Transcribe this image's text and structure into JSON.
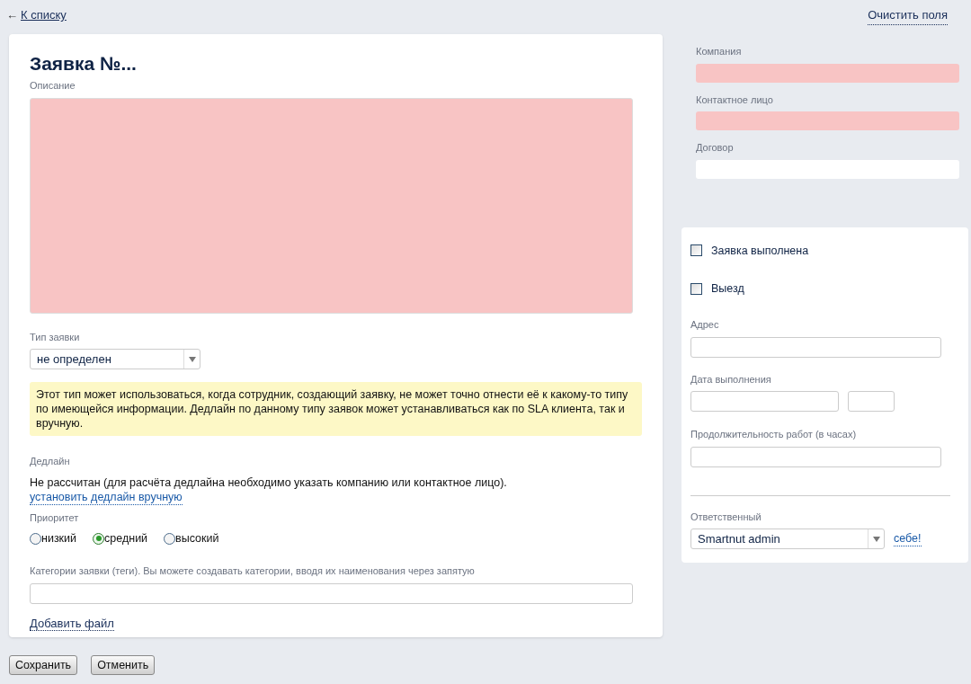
{
  "back_link": {
    "arrow": "←",
    "label": "К списку"
  },
  "clear_link": "Очистить поля",
  "form": {
    "title": "Заявка №...",
    "description": {
      "label": "Описание",
      "invalid": true
    },
    "type": {
      "label": "Тип заявки",
      "value": "не определен"
    },
    "type_hint": "Этот тип может использоваться, когда сотрудник, создающий заявку, не может точно отнести её к какому-то типу по имеющейся информации. Дедлайн по данному типу заявок может устанавливаться как по SLA клиента, так и вручную.",
    "deadline": {
      "label": "Дедлайн",
      "text": "Не рассчитан (для расчёта дедлайна необходимо указать компанию или контактное лицо).",
      "link": "установить дедлайн вручную"
    },
    "priority": {
      "label": "Приоритет",
      "options": [
        {
          "label": "низкий",
          "selected": false
        },
        {
          "label": "средний",
          "selected": true
        },
        {
          "label": "высокий",
          "selected": false
        }
      ]
    },
    "tags": {
      "label": "Категории заявки (теги). Вы можете создавать категории, вводя их наименования через запятую"
    },
    "add_file": "Добавить файл"
  },
  "client": [
    {
      "label": "Компания",
      "invalid": true
    },
    {
      "label": "Контактное лицо",
      "invalid": true
    },
    {
      "label": "Договор",
      "invalid": false
    }
  ],
  "details": {
    "checkboxes": [
      {
        "label": "Заявка выполнена",
        "checked": false
      },
      {
        "label": "Выезд",
        "checked": false
      }
    ],
    "address": {
      "label": "Адрес"
    },
    "date": {
      "label": "Дата выполнения"
    },
    "duration": {
      "label": "Продолжительность работ (в часах)"
    },
    "assignee": {
      "label": "Ответственный",
      "value": "Smartnut admin",
      "self_link": "себе!"
    }
  },
  "buttons": [
    "Сохранить",
    "Отменить"
  ]
}
